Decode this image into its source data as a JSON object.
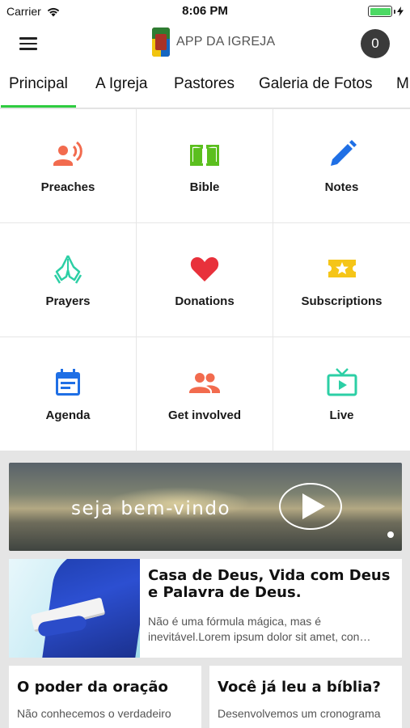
{
  "status_bar": {
    "carrier": "Carrier",
    "time": "8:06 PM"
  },
  "header": {
    "app_title": "APP DA IGREJA",
    "cart_count": "0"
  },
  "tabs": [
    {
      "label": "Principal",
      "active": true
    },
    {
      "label": "A Igreja"
    },
    {
      "label": "Pastores"
    },
    {
      "label": "Galeria de Fotos"
    },
    {
      "label": "M"
    }
  ],
  "menu": [
    {
      "label": "Preaches",
      "icon": "preach-icon",
      "color": "#f26b4e"
    },
    {
      "label": "Bible",
      "icon": "book-icon",
      "color": "#5bbf1e"
    },
    {
      "label": "Notes",
      "icon": "pencil-icon",
      "color": "#1f6fe5"
    },
    {
      "label": "Prayers",
      "icon": "praying-hands-icon",
      "color": "#2ccfa5"
    },
    {
      "label": "Donations",
      "icon": "heart-icon",
      "color": "#e8313b"
    },
    {
      "label": "Subscriptions",
      "icon": "ticket-star-icon",
      "color": "#f5c518"
    },
    {
      "label": "Agenda",
      "icon": "calendar-icon",
      "color": "#1f6fe5"
    },
    {
      "label": "Get involved",
      "icon": "group-icon",
      "color": "#f26b4e"
    },
    {
      "label": "Live",
      "icon": "tv-play-icon",
      "color": "#2ccfa5"
    }
  ],
  "banner": {
    "text": "seja bem-vindo"
  },
  "article": {
    "title": "Casa de Deus, Vida com Deus e Palavra de Deus.",
    "description": "Não é uma fórmula mágica, mas é inevitável.Lorem ipsum dolor sit amet, con…"
  },
  "cards": [
    {
      "title": "O poder da oração",
      "description": "Não conhecemos o verdadeiro"
    },
    {
      "title": "Você já leu a bíblia?",
      "description": "Desenvolvemos um cronograma"
    }
  ],
  "colors": {
    "accent": "#2ecc40",
    "badge": "#3a3a3a",
    "feed_bg": "#e5e5e5"
  }
}
